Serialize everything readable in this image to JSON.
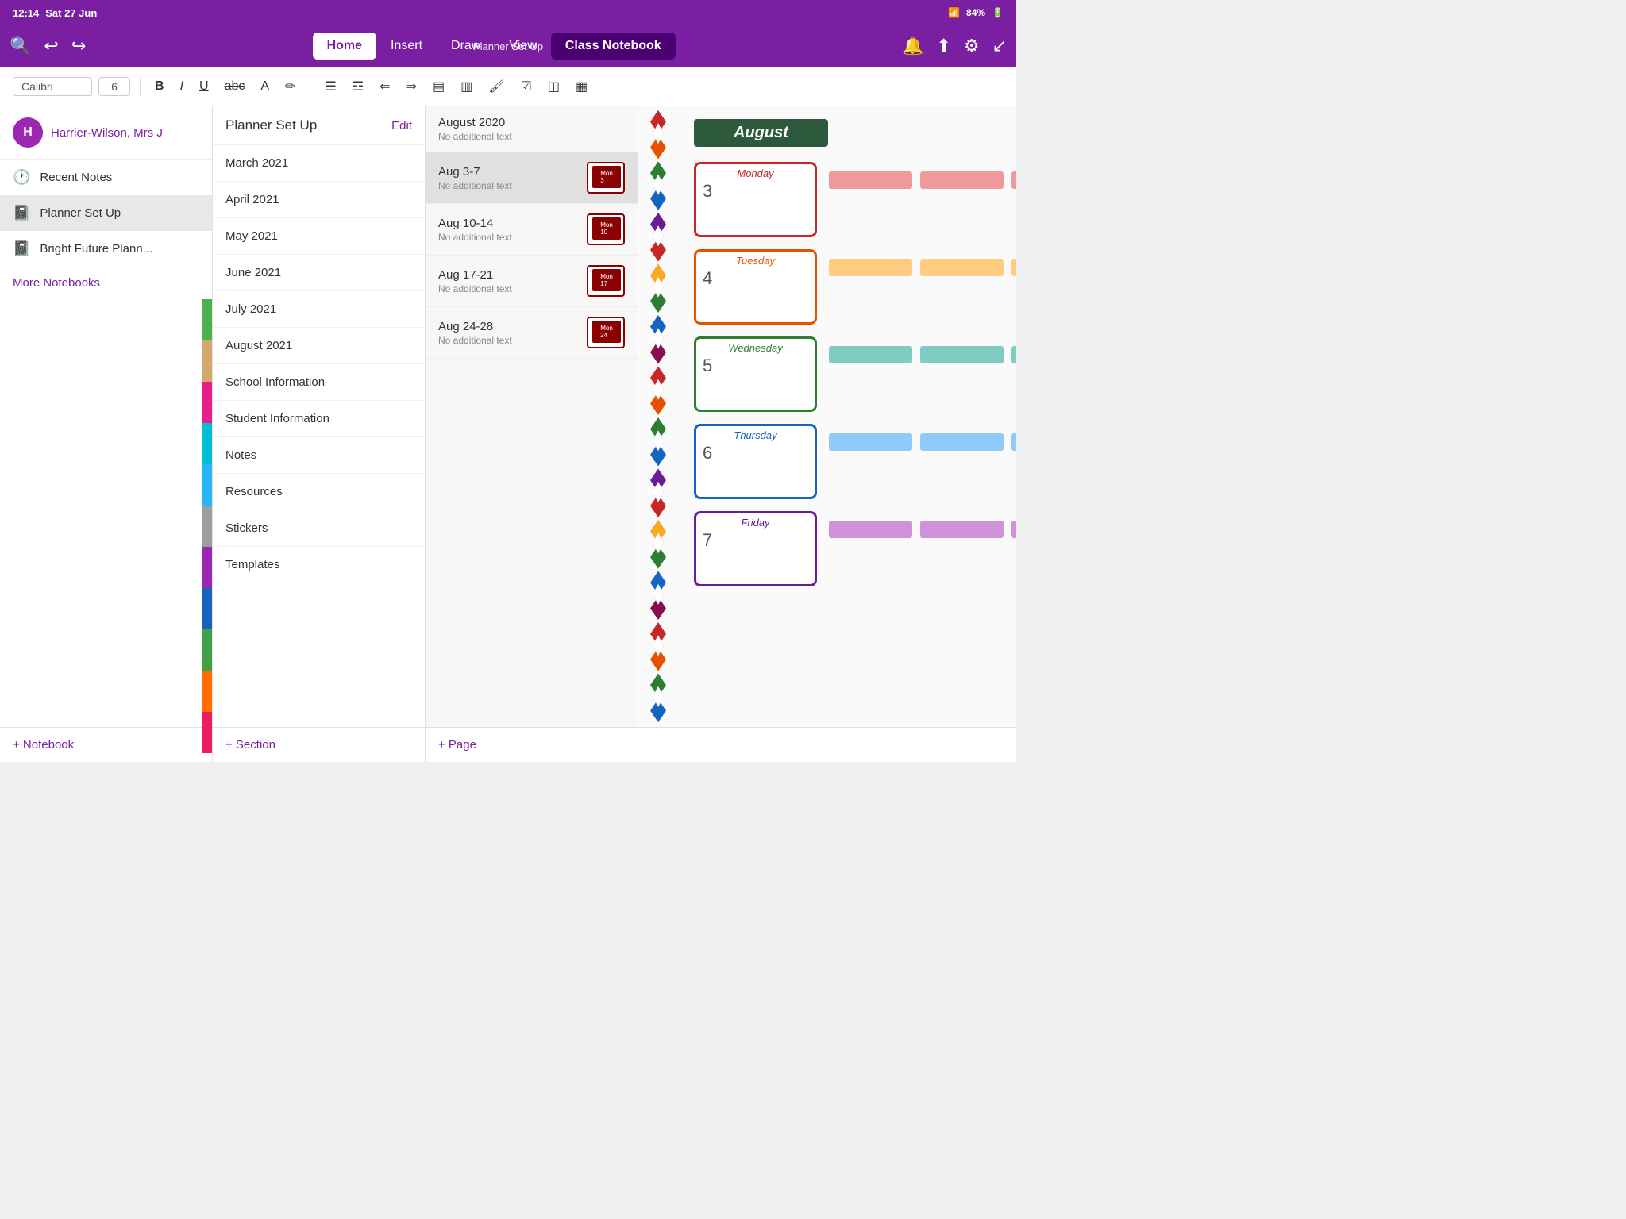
{
  "statusBar": {
    "time": "12:14",
    "date": "Sat 27 Jun",
    "wifi": "WiFi",
    "battery": "84%"
  },
  "titleBar": {
    "pageTitle": "Planner Set Up",
    "tabs": [
      "Home",
      "Insert",
      "Draw",
      "View"
    ],
    "activeTab": "Home",
    "classNotebook": "Class Notebook"
  },
  "toolbar": {
    "fontName": "Calibri",
    "fontSize": "6"
  },
  "sidebar": {
    "userName": "Harrier-Wilson, Mrs J",
    "items": [
      {
        "label": "Recent Notes",
        "icon": "🕐"
      },
      {
        "label": "Planner Set Up",
        "icon": "📓"
      },
      {
        "label": "Bright Future Plann...",
        "icon": "📓"
      }
    ],
    "moreLabel": "More Notebooks"
  },
  "sectionPanel": {
    "title": "Planner Set Up",
    "editLabel": "Edit",
    "sections": [
      "March 2021",
      "April 2021",
      "May 2021",
      "June 2021",
      "July 2021",
      "August 2021",
      "School Information",
      "Student Information",
      "Notes",
      "Resources",
      "Stickers",
      "Templates"
    ]
  },
  "pagesPanel": {
    "pages": [
      {
        "title": "August 2020",
        "subtitle": "No additional text",
        "thumb": false
      },
      {
        "title": "Aug 3-7",
        "subtitle": "No additional text",
        "thumb": true,
        "active": true
      },
      {
        "title": "Aug 10-14",
        "subtitle": "No additional text",
        "thumb": true
      },
      {
        "title": "Aug 17-21",
        "subtitle": "No additional text",
        "thumb": true
      },
      {
        "title": "Aug 24-28",
        "subtitle": "No additional text",
        "thumb": true
      }
    ]
  },
  "planner": {
    "monthHeader": "August",
    "days": [
      {
        "name": "Monday",
        "number": "3",
        "color": "monday"
      },
      {
        "name": "Tuesday",
        "number": "4",
        "color": "tuesday"
      },
      {
        "name": "Wednesday",
        "number": "5",
        "color": "wednesday"
      },
      {
        "name": "Thursday",
        "number": "6",
        "color": "thursday"
      },
      {
        "name": "Friday",
        "number": "7",
        "color": "friday"
      }
    ]
  },
  "bottomBar": {
    "addNotebook": "+ Notebook",
    "addSection": "+ Section",
    "addPage": "+ Page"
  }
}
